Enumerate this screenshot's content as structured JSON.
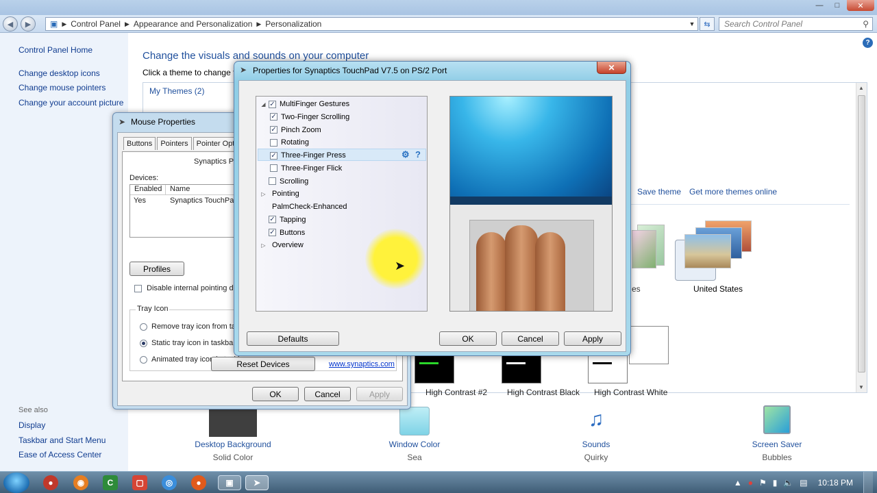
{
  "explorer": {
    "breadcrumb": [
      "Control Panel",
      "Appearance and Personalization",
      "Personalization"
    ],
    "search_placeholder": "Search Control Panel",
    "left_links": [
      "Control Panel Home",
      "Change desktop icons",
      "Change mouse pointers",
      "Change your account picture"
    ],
    "see_also_label": "See also",
    "see_also_links": [
      "Display",
      "Taskbar and Start Menu",
      "Ease of Access Center"
    ],
    "main_title": "Change the visuals and sounds on your computer",
    "main_subtitle": "Click a theme to change th",
    "my_themes": "My Themes (2)",
    "save_theme": "Save theme",
    "get_more_themes": "Get more themes online",
    "theme_partial_label": "es",
    "theme_selected_label": "United States",
    "high_contrast": [
      "High Contrast #2",
      "High Contrast Black",
      "High Contrast White"
    ],
    "bottom_items": [
      {
        "label": "Desktop Background",
        "sub": "Solid Color"
      },
      {
        "label": "Window Color",
        "sub": "Sea"
      },
      {
        "label": "Sounds",
        "sub": "Quirky"
      },
      {
        "label": "Screen Saver",
        "sub": "Bubbles"
      }
    ]
  },
  "mouse_dialog": {
    "title": "Mouse Properties",
    "tabs": [
      "Buttons",
      "Pointers",
      "Pointer Options"
    ],
    "synaptics_label": "Synaptics Poi",
    "devices_label": "Devices:",
    "columns": [
      "Enabled",
      "Name"
    ],
    "device_row": {
      "enabled": "Yes",
      "name": "Synaptics TouchPad"
    },
    "profiles_btn": "Profiles",
    "disable_internal": "Disable internal pointing device",
    "tray_icon_legend": "Tray Icon",
    "tray_options": [
      "Remove tray icon from taskbar",
      "Static tray icon in taskbar",
      "Animated tray icon in taskbar"
    ],
    "reset_btn": "Reset Devices",
    "link": "www.synaptics.com",
    "ok": "OK",
    "cancel": "Cancel",
    "apply": "Apply"
  },
  "syn_dialog": {
    "title": "Properties for Synaptics TouchPad V7.5 on PS/2 Port",
    "tree": [
      {
        "label": "MultiFinger Gestures",
        "checked": true,
        "level": 0,
        "expander": "open"
      },
      {
        "label": "Two-Finger Scrolling",
        "checked": true,
        "level": 1
      },
      {
        "label": "Pinch Zoom",
        "checked": true,
        "level": 1
      },
      {
        "label": "Rotating",
        "checked": false,
        "level": 1
      },
      {
        "label": "Three-Finger Press",
        "checked": true,
        "level": 1,
        "selected": true
      },
      {
        "label": "Three-Finger Flick",
        "checked": false,
        "level": 1
      },
      {
        "label": "Scrolling",
        "checked": false,
        "level": 0
      },
      {
        "label": "Pointing",
        "level": 0,
        "expander": "closed"
      },
      {
        "label": "PalmCheck-Enhanced",
        "level": 0
      },
      {
        "label": "Tapping",
        "checked": true,
        "level": 0
      },
      {
        "label": "Buttons",
        "checked": true,
        "level": 0
      },
      {
        "label": "Overview",
        "level": 0,
        "expander": "closed"
      }
    ],
    "defaults": "Defaults",
    "ok": "OK",
    "cancel": "Cancel",
    "apply": "Apply"
  },
  "taskbar": {
    "clock": "10:18 PM"
  }
}
